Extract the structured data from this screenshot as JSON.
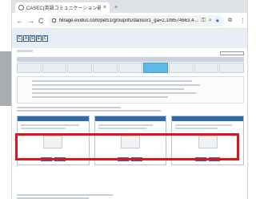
{
  "browser": {
    "tab_title": "CASEC(英語コミュニケーション能力...",
    "tab_close": "×",
    "new_tab": "+",
    "nav_back": "←",
    "nav_forward": "→",
    "nav_reload": "C",
    "url": "hilrage.evidus.com/pets1/group/ifs/daniso/1_ga=2.108574663.4..."
  },
  "site": {
    "logo_letters": [
      "C",
      "A",
      "S",
      "E",
      "C"
    ],
    "highlight_color": "#e1141b"
  }
}
